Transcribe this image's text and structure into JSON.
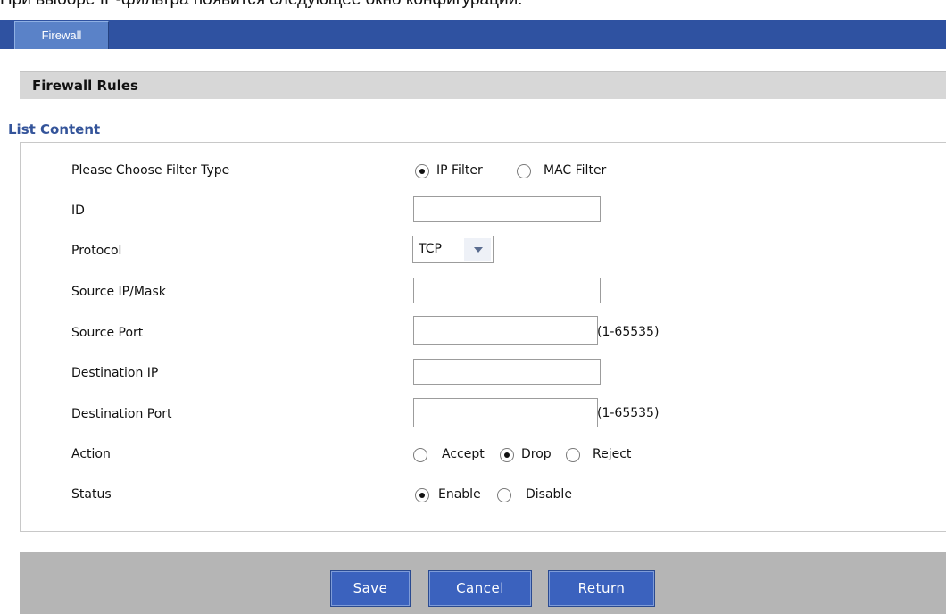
{
  "caption": "При выборе IP-фильтра появится следующее окно конфигурации:",
  "tabs": [
    {
      "label": "Firewall",
      "active": true
    }
  ],
  "section_title": "Firewall Rules",
  "list_title": "List Content",
  "form": {
    "filter_type": {
      "label": "Please Choose Filter Type",
      "options": [
        "IP Filter",
        "MAC Filter"
      ],
      "selected": "IP Filter"
    },
    "id": {
      "label": "ID",
      "value": ""
    },
    "protocol": {
      "label": "Protocol",
      "value": "TCP"
    },
    "source_ip_mask": {
      "label": "Source IP/Mask",
      "value": ""
    },
    "source_port": {
      "label": "Source Port",
      "value": "",
      "hint": "(1-65535)"
    },
    "destination_ip": {
      "label": "Destination IP",
      "value": ""
    },
    "destination_port": {
      "label": "Destination Port",
      "value": "",
      "hint": "(1-65535)"
    },
    "action": {
      "label": "Action",
      "options": [
        "Accept",
        "Drop",
        "Reject"
      ],
      "selected": "Drop"
    },
    "status": {
      "label": "Status",
      "options": [
        "Enable",
        "Disable"
      ],
      "selected": "Enable"
    }
  },
  "buttons": {
    "save": "Save",
    "cancel": "Cancel",
    "return": "Return"
  },
  "colors": {
    "topbar": "#2f52a1",
    "tab": "#5a82c8",
    "button": "#3b62be",
    "list_title": "#34549a",
    "section_header_bg": "#d7d7d7",
    "footer_bg": "#b5b5b5"
  }
}
